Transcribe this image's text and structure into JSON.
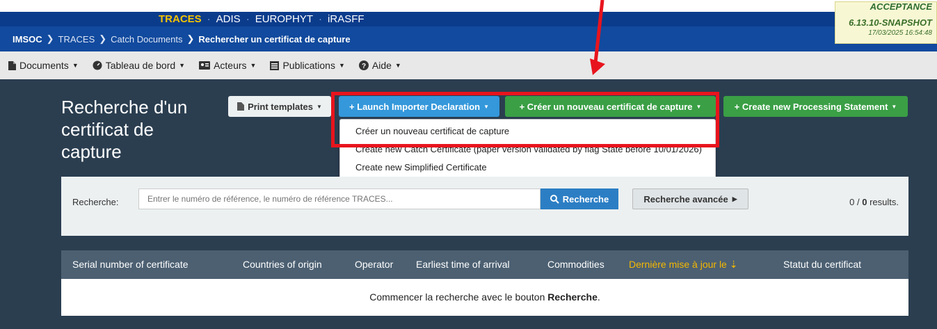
{
  "apps": {
    "active": "TRACES",
    "items": [
      "ADIS",
      "EUROPHYT",
      "iRASFF"
    ],
    "separator": "·"
  },
  "breadcrumb": {
    "root": "IMSOC",
    "items": [
      "TRACES",
      "Catch Documents"
    ],
    "current": "Rechercher un certificat de capture"
  },
  "version": {
    "top": "ACCEPTANCE",
    "number": "6.13.10-SNAPSHOT",
    "timestamp": "17/03/2025 16:54:48"
  },
  "menu": {
    "documents": "Documents",
    "dashboard": "Tableau de bord",
    "actors": "Acteurs",
    "publications": "Publications",
    "help": "Aide"
  },
  "page": {
    "title": "Recherche d'un certificat de capture"
  },
  "actions": {
    "print_templates": "Print templates",
    "launch_importer": "+ Launch Importer Declaration",
    "create_catch_cert": "+ Créer un nouveau certificat de capture",
    "create_processing": "+ Create new Processing Statement"
  },
  "dropdown": {
    "items": [
      "Créer un nouveau certificat de capture",
      "Create new Catch Certificate (paper version validated by flag State before 10/01/2026)",
      "Create new Simplified Certificate"
    ]
  },
  "search": {
    "label": "Recherche:",
    "placeholder": "Entrer le numéro de référence, le numéro de référence TRACES...",
    "button": "Recherche",
    "advanced": "Recherche avancée",
    "count_prefix": "0 / ",
    "count_total": "0",
    "count_suffix": " results."
  },
  "table": {
    "columns": [
      "Serial number of certificate",
      "Countries of origin",
      "Operator",
      "Earliest time of arrival",
      "Commodities",
      "Dernière mise à jour le",
      "Statut du certificat"
    ],
    "empty_prefix": "Commencer la recherche avec le bouton ",
    "empty_bold": "Recherche",
    "empty_suffix": "."
  },
  "colors": {
    "topbar": "#0b3c8c",
    "main_bg": "#2b3e50",
    "highlight": "#e8141d",
    "accent_green": "#3a9f45",
    "accent_blue": "#3498db",
    "sort_active": "#f5b800"
  }
}
